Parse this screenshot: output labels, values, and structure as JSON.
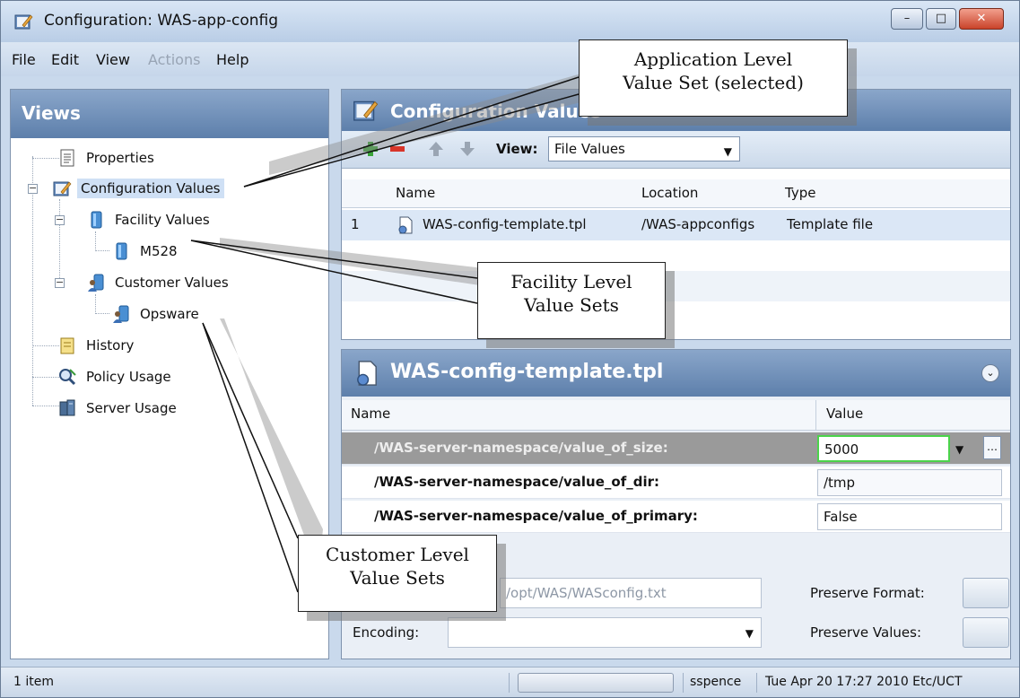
{
  "window": {
    "title": "Configuration: WAS-app-config",
    "controls": {
      "minimize": "–",
      "maximize": "□",
      "close": "✕"
    }
  },
  "menu": [
    "File",
    "Edit",
    "View",
    "Actions",
    "Help"
  ],
  "views_panel": {
    "title": "Views",
    "tree": [
      {
        "label": "Properties",
        "icon": "properties-icon"
      },
      {
        "label": "Configuration Values",
        "icon": "configuration-values-icon",
        "selected": true
      },
      {
        "label": "Facility Values",
        "icon": "facility-icon"
      },
      {
        "label": "M528",
        "icon": "facility-icon"
      },
      {
        "label": "Customer Values",
        "icon": "customer-icon"
      },
      {
        "label": "Opsware",
        "icon": "customer-icon"
      },
      {
        "label": "History",
        "icon": "history-icon"
      },
      {
        "label": "Policy Usage",
        "icon": "policy-usage-icon"
      },
      {
        "label": "Server Usage",
        "icon": "server-usage-icon"
      }
    ]
  },
  "config_values_panel": {
    "title": "Configuration Values",
    "toolbar": {
      "view_label": "View:",
      "view_selected": "File Values"
    },
    "columns": [
      "Name",
      "Location",
      "Type"
    ],
    "rows": [
      {
        "index": "1",
        "name": "WAS-config-template.tpl",
        "location": "/WAS-appconfigs",
        "type": "Template file"
      }
    ]
  },
  "file_panel": {
    "title": "WAS-config-template.tpl",
    "columns": [
      "Name",
      "Value"
    ],
    "properties": [
      {
        "name": "/WAS-server-namespace/value_of_size:",
        "value": "5000"
      },
      {
        "name": "/WAS-server-namespace/value_of_dir:",
        "value": "/tmp"
      },
      {
        "name": "/WAS-server-namespace/value_of_primary:",
        "value": "False"
      }
    ],
    "path_value": "/opt/WAS/WASconfig.txt",
    "encoding_label": "Encoding:",
    "preserve_format_label": "Preserve Format:",
    "preserve_values_label": "Preserve Values:"
  },
  "status": {
    "items": "1 item",
    "user": "sspence",
    "datetime": "Tue Apr 20 17:27 2010 Etc/UCT"
  },
  "callouts": {
    "application": [
      "Application Level",
      "Value Set (selected)"
    ],
    "facility": [
      "Facility Level",
      "Value Sets"
    ],
    "customer": [
      "Customer Level",
      "Value Sets"
    ]
  }
}
